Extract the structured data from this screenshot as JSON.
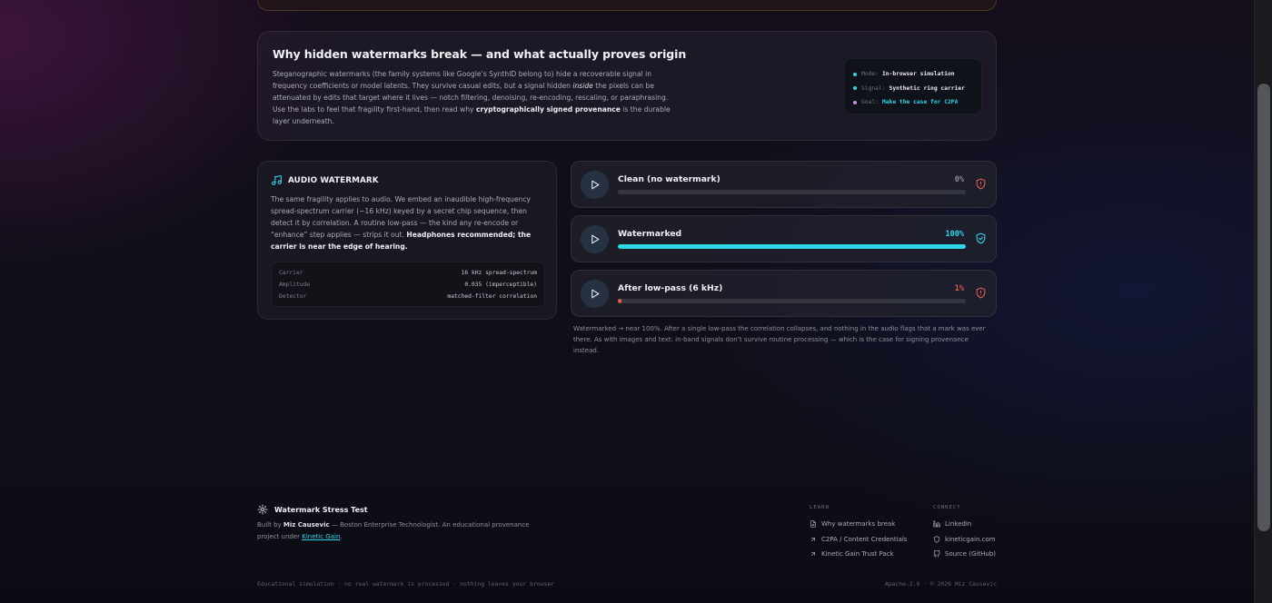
{
  "intro": {
    "title": "Why hidden watermarks break — and what actually proves origin",
    "p_1": "Steganographic watermarks (the family systems like Google’s SynthID belong to) hide a recoverable signal in frequency coefficients or model latents. They survive casual edits, but a signal hidden ",
    "p_em": "inside",
    "p_2": " the pixels can be attenuated by edits that target where it lives — notch filtering, denoising, re-encoding, rescaling, or paraphrasing. Use the labs to feel that fragility first-hand, then read why ",
    "p_strong": "cryptographically signed provenance",
    "p_3": " is the durable layer underneath.",
    "meta": [
      {
        "key": "Mode:",
        "value": "In-browser simulation",
        "dot_color": "#2fd6e8"
      },
      {
        "key": "Signal:",
        "value": "Synthetic ring carrier",
        "dot_color": "#2fd6e8"
      },
      {
        "key": "Goal:",
        "value": "Make the case for C2PA",
        "dot_color": "#c98cf0"
      }
    ]
  },
  "audio": {
    "title": "AUDIO WATERMARK",
    "icon": "music-note-icon",
    "p_1": "The same fragility applies to audio. We embed an inaudible high-frequency spread-spectrum carrier (~16 kHz) keyed by a secret chip sequence, then detect it by correlation. A routine low-pass — the kind any re-encode or “enhance” step applies — strips it out. ",
    "p_strong": "Headphones recommended; the carrier is near the edge of hearing.",
    "specs": [
      {
        "key": "Carrier",
        "value": "16 kHz spread-spectrum"
      },
      {
        "key": "Amplitude",
        "value": "0.035 (imperceptible)"
      },
      {
        "key": "Detector",
        "value": "matched-filter correlation"
      }
    ]
  },
  "tracks": [
    {
      "label": "Clean (no watermark)",
      "pct": "0%",
      "fill": 0,
      "color": "#8b8e99",
      "fill_color": "#2fd6e8",
      "status": "shield-alert-icon",
      "status_color": "#e05a4f"
    },
    {
      "label": "Watermarked",
      "pct": "100%",
      "fill": 100,
      "color": "#2fd6e8",
      "fill_color": "#2fd6e8",
      "status": "shield-check-icon",
      "status_color": "#2fd6e8"
    },
    {
      "label": "After low-pass (6 kHz)",
      "pct": "1%",
      "fill": 1,
      "color": "#e05a4f",
      "fill_color": "#e05a4f",
      "status": "shield-alert-icon",
      "status_color": "#e05a4f"
    }
  ],
  "note": "Watermarked → near 100%. After a single low-pass the correlation collapses, and nothing in the audio flags that a mark was ever there. As with images and text: in-band signals don’t survive routine processing — which is the case for signing provenance instead.",
  "footer": {
    "brand": "Watermark Stress Test",
    "built_by": "Built by ",
    "author": "Miz Causevic",
    "built_rest": " — Boston Enterprise Technologist. An educational provenance project under ",
    "org_link": "Kinetic Gain",
    "period": ".",
    "learn_heading": "LEARN",
    "learn": [
      {
        "label": "Why watermarks break",
        "icon": "document-icon"
      },
      {
        "label": "C2PA / Content Credentials",
        "icon": "arrow-up-right-icon"
      },
      {
        "label": "Kinetic Gain Trust Pack",
        "icon": "arrow-up-right-icon"
      }
    ],
    "connect_heading": "CONNECT",
    "connect": [
      {
        "label": "LinkedIn",
        "icon": "linkedin-icon"
      },
      {
        "label": "kineticgain.com",
        "icon": "shield-icon"
      },
      {
        "label": "Source (GitHub)",
        "icon": "github-icon"
      }
    ],
    "bottom_left": "Educational simulation · no real watermark is processed · nothing leaves your browser",
    "bottom_right": "Apache-2.0 · © 2026 Miz Causevic"
  },
  "colors": {
    "accent": "#2fd6e8",
    "danger": "#e05a4f"
  }
}
